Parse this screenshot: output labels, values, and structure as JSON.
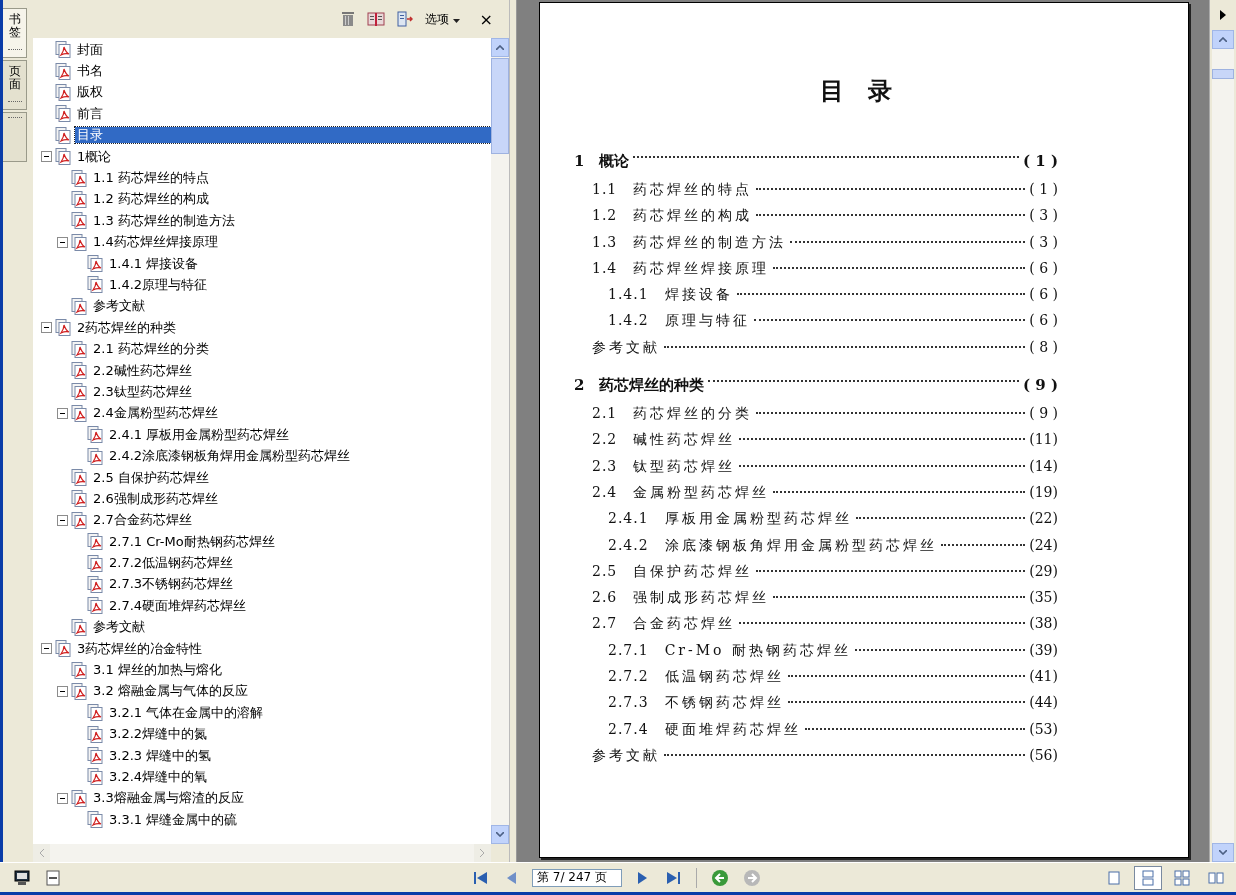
{
  "side_tabs": [
    {
      "label": "书签",
      "selected": true
    },
    {
      "label": "页面",
      "selected": false
    },
    {
      "selected": false
    }
  ],
  "panel_toolbar": {
    "options_label": "选项",
    "close": "×"
  },
  "bookmarks": [
    {
      "label": "封面",
      "selected": false
    },
    {
      "label": "书名",
      "selected": false
    },
    {
      "label": "版权",
      "selected": false
    },
    {
      "label": "前言",
      "selected": false
    },
    {
      "label": "目录",
      "selected": true
    },
    {
      "label": "1概论",
      "selected": false,
      "expanded": true,
      "children": [
        {
          "label": "1.1 药芯焊丝的特点",
          "selected": false
        },
        {
          "label": "1.2 药芯焊丝的构成",
          "selected": false
        },
        {
          "label": "1.3 药芯焊丝的制造方法",
          "selected": false
        },
        {
          "label": "1.4药芯焊丝焊接原理",
          "selected": false,
          "expanded": true,
          "children": [
            {
              "label": "1.4.1 焊接设备",
              "selected": false
            },
            {
              "label": "1.4.2原理与特征",
              "selected": false
            }
          ]
        },
        {
          "label": "参考文献",
          "selected": false
        }
      ]
    },
    {
      "label": "2药芯焊丝的种类",
      "selected": false,
      "expanded": true,
      "children": [
        {
          "label": "2.1 药芯焊丝的分类",
          "selected": false
        },
        {
          "label": "2.2碱性药芯焊丝",
          "selected": false
        },
        {
          "label": "2.3钛型药芯焊丝",
          "selected": false
        },
        {
          "label": "2.4金属粉型药芯焊丝",
          "selected": false,
          "expanded": true,
          "children": [
            {
              "label": "2.4.1 厚板用金属粉型药芯焊丝",
              "selected": false
            },
            {
              "label": "2.4.2涂底漆钢板角焊用金属粉型药芯焊丝",
              "selected": false
            }
          ]
        },
        {
          "label": "2.5 自保护药芯焊丝",
          "selected": false
        },
        {
          "label": "2.6强制成形药芯焊丝",
          "selected": false
        },
        {
          "label": "2.7合金药芯焊丝",
          "selected": false,
          "expanded": true,
          "children": [
            {
              "label": "2.7.1 Cr-Mo耐热钢药芯焊丝",
              "selected": false
            },
            {
              "label": "2.7.2低温钢药芯焊丝",
              "selected": false
            },
            {
              "label": "2.7.3不锈钢药芯焊丝",
              "selected": false
            },
            {
              "label": "2.7.4硬面堆焊药芯焊丝",
              "selected": false
            }
          ]
        },
        {
          "label": "参考文献",
          "selected": false
        }
      ]
    },
    {
      "label": "3药芯焊丝的冶金特性",
      "selected": false,
      "expanded": true,
      "children": [
        {
          "label": "3.1 焊丝的加热与熔化",
          "selected": false
        },
        {
          "label": "3.2 熔融金属与气体的反应",
          "selected": false,
          "expanded": true,
          "children": [
            {
              "label": "3.2.1 气体在金属中的溶解",
              "selected": false
            },
            {
              "label": "3.2.2焊缝中的氮",
              "selected": false
            },
            {
              "label": "3.2.3 焊缝中的氢",
              "selected": false
            },
            {
              "label": "3.2.4焊缝中的氧",
              "selected": false
            }
          ]
        },
        {
          "label": "3.3熔融金属与熔渣的反应",
          "selected": false,
          "expanded": true,
          "children": [
            {
              "label": "3.3.1 焊缝金属中的硫",
              "selected": false
            }
          ]
        }
      ]
    }
  ],
  "document": {
    "title": "目　录",
    "toc": [
      {
        "kind": "chapter",
        "number": "1",
        "title": "概论",
        "page": "( 1 )"
      },
      {
        "kind": "section",
        "number": "1.1",
        "title": "药芯焊丝的特点",
        "page": "( 1 )"
      },
      {
        "kind": "section",
        "number": "1.2",
        "title": "药芯焊丝的构成",
        "page": "( 3 )"
      },
      {
        "kind": "section",
        "number": "1.3",
        "title": "药芯焊丝的制造方法",
        "page": "( 3 )"
      },
      {
        "kind": "section",
        "number": "1.4",
        "title": "药芯焊丝焊接原理",
        "page": "( 6 )"
      },
      {
        "kind": "subsection",
        "number": "1.4.1",
        "title": "焊接设备",
        "page": "( 6 )"
      },
      {
        "kind": "subsection",
        "number": "1.4.2",
        "title": "原理与特征",
        "page": "( 6 )"
      },
      {
        "kind": "references",
        "title": "参考文献",
        "page": "( 8 )"
      },
      {
        "kind": "chapter",
        "number": "2",
        "title": "药芯焊丝的种类",
        "page": "( 9 )"
      },
      {
        "kind": "section",
        "number": "2.1",
        "title": "药芯焊丝的分类",
        "page": "( 9 )"
      },
      {
        "kind": "section",
        "number": "2.2",
        "title": "碱性药芯焊丝",
        "page": "(11)"
      },
      {
        "kind": "section",
        "number": "2.3",
        "title": "钛型药芯焊丝",
        "page": "(14)"
      },
      {
        "kind": "section",
        "number": "2.4",
        "title": "金属粉型药芯焊丝",
        "page": "(19)"
      },
      {
        "kind": "subsection",
        "number": "2.4.1",
        "title": "厚板用金属粉型药芯焊丝",
        "page": "(22)"
      },
      {
        "kind": "subsection",
        "number": "2.4.2",
        "title": "涂底漆钢板角焊用金属粉型药芯焊丝",
        "page": "(24)"
      },
      {
        "kind": "section",
        "number": "2.5",
        "title": "自保护药芯焊丝",
        "page": "(29)"
      },
      {
        "kind": "section",
        "number": "2.6",
        "title": "强制成形药芯焊丝",
        "page": "(35)"
      },
      {
        "kind": "section",
        "number": "2.7",
        "title": "合金药芯焊丝",
        "page": "(38)"
      },
      {
        "kind": "subsection",
        "number": "2.7.1",
        "title": "Cr-Mo 耐热钢药芯焊丝",
        "page": "(39)"
      },
      {
        "kind": "subsection",
        "number": "2.7.2",
        "title": "低温钢药芯焊丝",
        "page": "(41)"
      },
      {
        "kind": "subsection",
        "number": "2.7.3",
        "title": "不锈钢药芯焊丝",
        "page": "(44)"
      },
      {
        "kind": "subsection",
        "number": "2.7.4",
        "title": "硬面堆焊药芯焊丝",
        "page": "(53)"
      },
      {
        "kind": "references",
        "title": "参考文献",
        "page": "(56)"
      }
    ]
  },
  "page_field": {
    "value": "第 7/ 247 页"
  },
  "view_modes": [
    {
      "kind": "single",
      "selected": false
    },
    {
      "kind": "continuous",
      "selected": true
    },
    {
      "kind": "grid",
      "selected": false
    },
    {
      "kind": "facing",
      "selected": false
    }
  ]
}
